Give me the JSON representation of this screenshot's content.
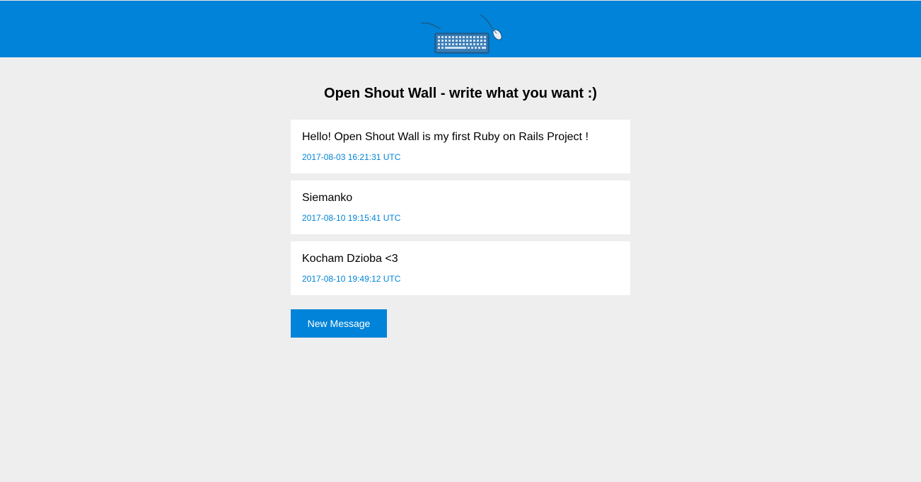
{
  "header": {
    "logo_icon": "keyboard-and-mouse-icon",
    "background": "#0083d8"
  },
  "main": {
    "title": "Open Shout Wall - write what you want :)",
    "messages": [
      {
        "text": "Hello! Open Shout Wall is my first Ruby on Rails Project !",
        "timestamp": "2017-08-03 16:21:31 UTC"
      },
      {
        "text": "Siemanko",
        "timestamp": "2017-08-10 19:15:41 UTC"
      },
      {
        "text": "Kocham Dzioba <3",
        "timestamp": "2017-08-10 19:49:12 UTC"
      }
    ],
    "new_message_label": "New Message"
  },
  "colors": {
    "accent": "#0083d8",
    "page_background": "#eeeeee",
    "card_background": "#ffffff"
  }
}
